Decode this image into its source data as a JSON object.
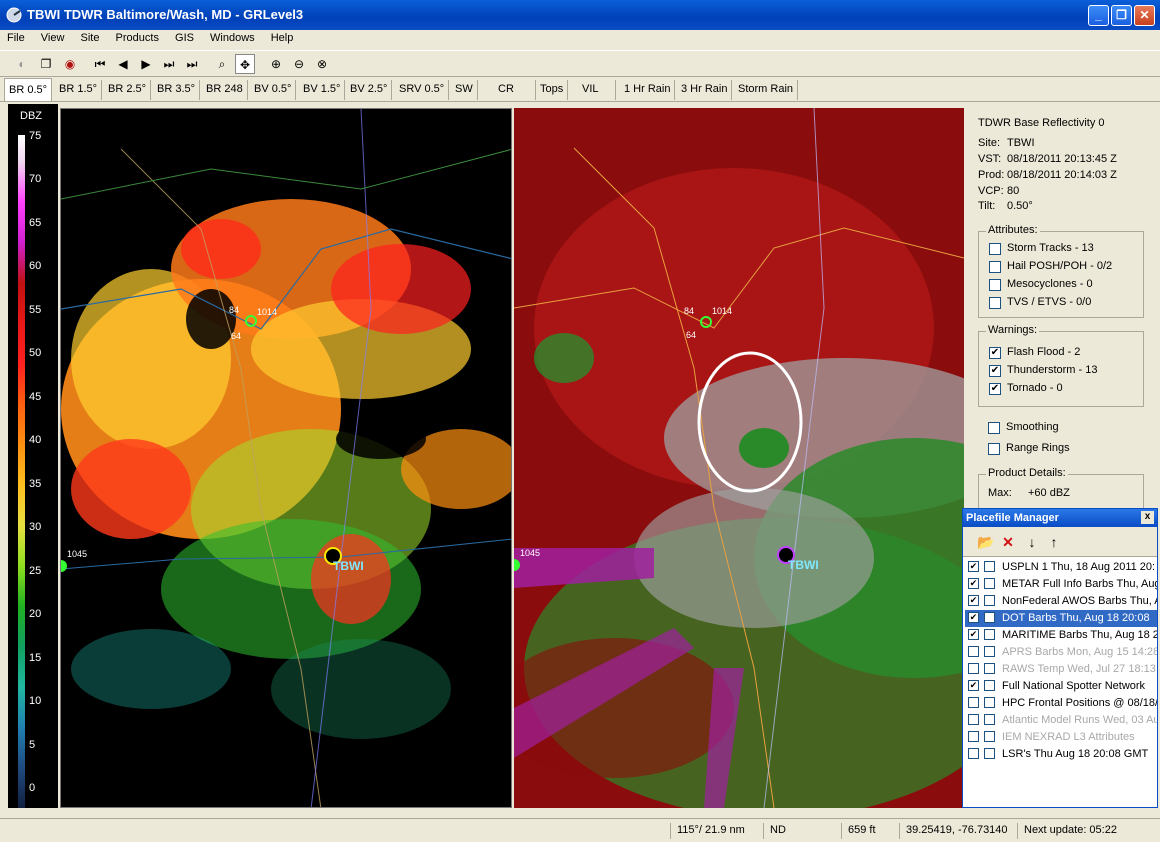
{
  "window": {
    "title": "TBWI TDWR Baltimore/Wash, MD - GRLevel3"
  },
  "menu": [
    "File",
    "View",
    "Site",
    "Products",
    "GIS",
    "Windows",
    "Help"
  ],
  "tabs": [
    "BR 0.5°",
    "BR 1.5°",
    "BR 2.5°",
    "BR 3.5°",
    "BR 248",
    "BV 0.5°",
    "BV 1.5°",
    "BV 2.5°",
    "SRV 0.5°",
    "SW",
    "CR",
    "Tops",
    "VIL",
    "1 Hr Rain",
    "3 Hr Rain",
    "Storm Rain"
  ],
  "active_tab": "BR 0.5°",
  "scale": {
    "label": "DBZ",
    "ticks": [
      "75",
      "70",
      "65",
      "60",
      "55",
      "50",
      "45",
      "40",
      "35",
      "30",
      "25",
      "20",
      "15",
      "10",
      "5",
      "0"
    ]
  },
  "radar": {
    "site_label": "TBWI",
    "station_left": "1045",
    "obs_a": "84",
    "obs_b": "1014",
    "obs_c": "64",
    "colors": {
      "reflectivity_bg": "#000000",
      "velocity_bg": "#9c0e0e",
      "circle": "#ffffff"
    }
  },
  "info": {
    "product": "TDWR Base Reflectivity 0",
    "site_label": "Site:",
    "site": "TBWI",
    "vst_label": "VST:",
    "vst": "08/18/2011  20:13:45 Z",
    "prod_label": "Prod:",
    "prod": "08/18/2011  20:14:03 Z",
    "vcp_label": "VCP:",
    "vcp": "80",
    "tilt_label": "Tilt:",
    "tilt": "0.50°",
    "attributes_title": "Attributes:",
    "attributes": [
      {
        "label": "Storm Tracks - 13",
        "checked": false
      },
      {
        "label": "Hail POSH/POH - 0/2",
        "checked": false
      },
      {
        "label": "Mesocyclones - 0",
        "checked": false
      },
      {
        "label": "TVS / ETVS - 0/0",
        "checked": false
      }
    ],
    "warnings_title": "Warnings:",
    "warnings": [
      {
        "label": "Flash Flood - 2",
        "checked": true
      },
      {
        "label": "Thunderstorm - 13",
        "checked": true
      },
      {
        "label": "Tornado - 0",
        "checked": true
      }
    ],
    "smoothing": "Smoothing",
    "range_rings": "Range Rings",
    "details_title": "Product Details:",
    "max_label": "Max:",
    "max": "+60 dBZ"
  },
  "placefile": {
    "title": "Placefile Manager",
    "close": "x",
    "rows": [
      {
        "text": "USPLN 1 Thu, 18 Aug 2011 20:",
        "checked": true,
        "selected": false,
        "dim": false
      },
      {
        "text": "METAR Full Info Barbs Thu, Aug",
        "checked": true,
        "selected": false,
        "dim": false
      },
      {
        "text": "NonFederal AWOS Barbs Thu, A",
        "checked": true,
        "selected": false,
        "dim": false
      },
      {
        "text": "DOT Barbs Thu, Aug 18 20:08",
        "checked": true,
        "selected": true,
        "dim": false
      },
      {
        "text": "MARITIME Barbs Thu, Aug 18 2",
        "checked": true,
        "selected": false,
        "dim": false
      },
      {
        "text": "APRS Barbs Mon, Aug 15 14:28",
        "checked": false,
        "selected": false,
        "dim": true
      },
      {
        "text": "RAWS Temp Wed, Jul 27 18:13",
        "checked": false,
        "selected": false,
        "dim": true
      },
      {
        "text": "Full National Spotter Network",
        "checked": true,
        "selected": false,
        "dim": false
      },
      {
        "text": "HPC Frontal Positions @ 08/18/",
        "checked": false,
        "selected": false,
        "dim": false
      },
      {
        "text": "Atlantic Model Runs Wed, 03 Au",
        "checked": false,
        "selected": false,
        "dim": true
      },
      {
        "text": "IEM NEXRAD L3 Attributes",
        "checked": false,
        "selected": false,
        "dim": true
      },
      {
        "text": "LSR's Thu Aug 18 20:08 GMT",
        "checked": false,
        "selected": false,
        "dim": false
      }
    ]
  },
  "status": {
    "bearing": "115°/ 21.9 nm",
    "value": "ND",
    "height": "659 ft",
    "coords": "39.25419, -76.73140",
    "next_update": "Next update: 05:22"
  }
}
